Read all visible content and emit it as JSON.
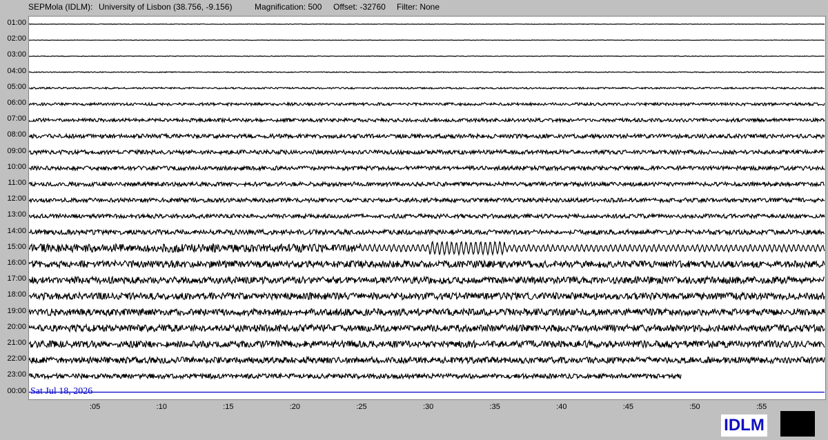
{
  "header": {
    "station": "SEPMola (IDLM):",
    "location": "University of Lisbon (38.756, -9.156)",
    "magnification": "Magnification: 500",
    "offset": "Offset: -32760",
    "filter": "Filter: None"
  },
  "hours": [
    "01:00",
    "02:00",
    "03:00",
    "04:00",
    "05:00",
    "06:00",
    "07:00",
    "08:00",
    "09:00",
    "10:00",
    "11:00",
    "12:00",
    "13:00",
    "14:00",
    "15:00",
    "16:00",
    "17:00",
    "18:00",
    "19:00",
    "20:00",
    "21:00",
    "22:00",
    "23:00",
    "00:00"
  ],
  "minutes": [
    ":05",
    ":10",
    ":15",
    ":20",
    ":25",
    ":30",
    ":35",
    ":40",
    ":45",
    ":50",
    ":55"
  ],
  "date_label": "Sat Jul 18, 2026",
  "logo": "IDLM",
  "colors": {
    "trace": "#000000",
    "date": "#0000cc",
    "logo_text": "#1010c0"
  }
}
